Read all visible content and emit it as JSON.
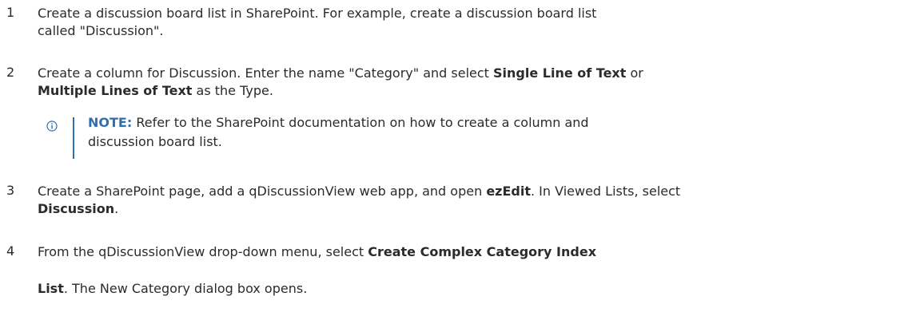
{
  "steps": [
    {
      "number": "1",
      "lines": [
        {
          "text": "Create a discussion board list in SharePoint. For example, create a discussion board list"
        },
        {
          "text": "called \"Discussion\"."
        }
      ]
    },
    {
      "number": "2",
      "line1_a": "Create a column for Discussion. Enter the name \"Category\" and select ",
      "line1_b": "Single Line of Text",
      "line1_c": " or",
      "line2_a": "Multiple Lines of Text",
      "line2_b": " as the Type."
    },
    {
      "number": "3",
      "line1_a": "Create a SharePoint page, add a qDiscussionView web app, and open ",
      "line1_b": "ezEdit",
      "line1_c": ". In Viewed Lists, select",
      "line2_a": "Discussion",
      "line2_b": "."
    },
    {
      "number": "4",
      "line1_a": "From the qDiscussionView drop-down menu, select ",
      "line1_b": "Create Complex Category Index",
      "line2_a": "List",
      "line2_b": ". The New Category dialog box opens."
    }
  ],
  "note": {
    "icon": "info-icon",
    "label": "NOTE:",
    "line1": " Refer to the SharePoint documentation on how to create a column and",
    "line2": "discussion board list.",
    "accent_color": "#2f6fb0"
  }
}
